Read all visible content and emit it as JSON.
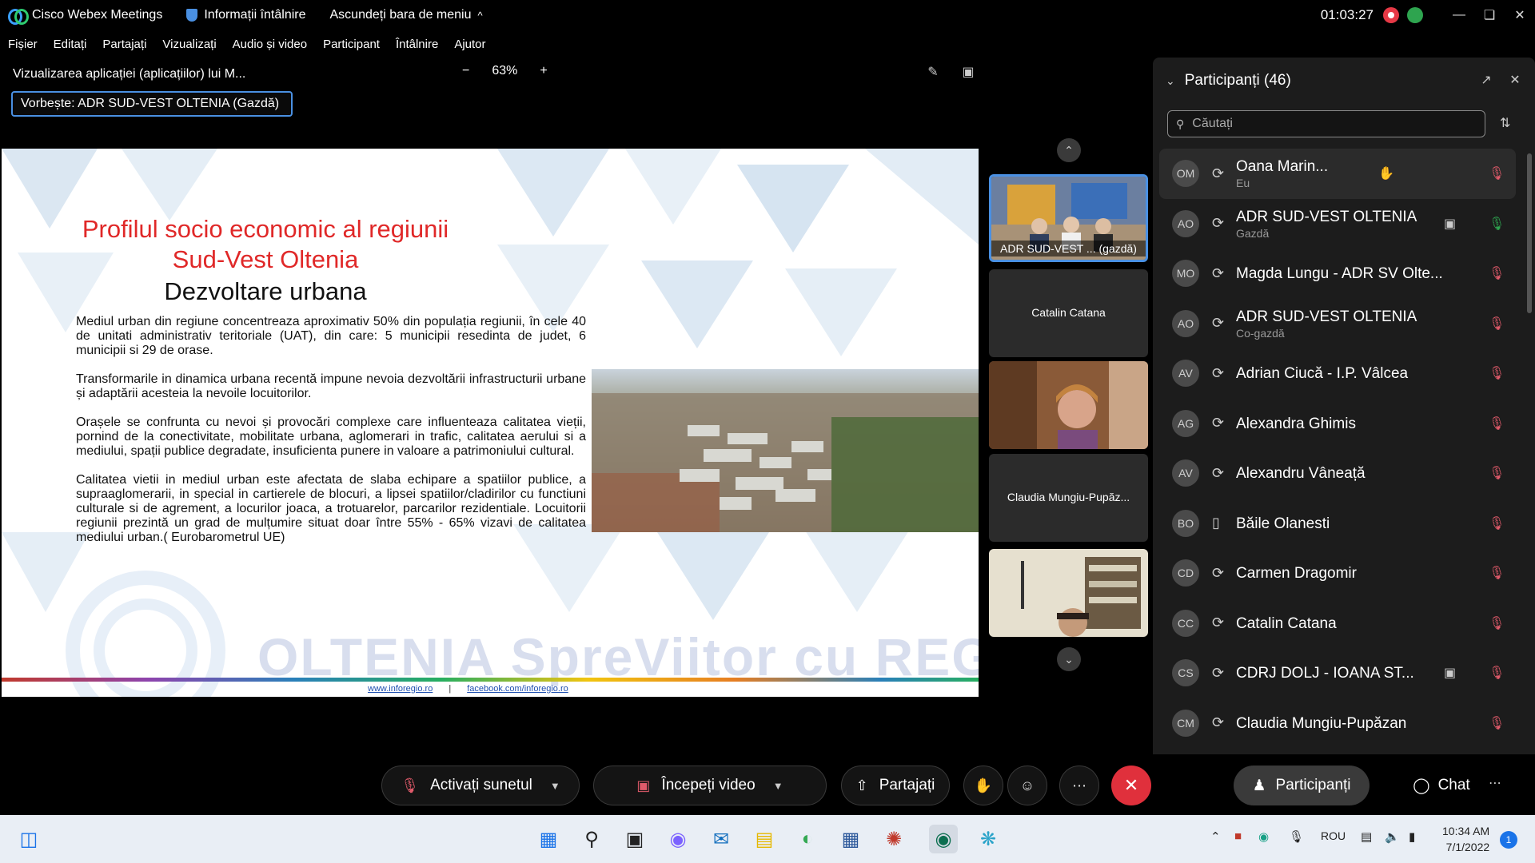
{
  "titlebar": {
    "app_name": "Cisco Webex Meetings",
    "meeting_info": "Informații întâlnire",
    "hide_menu": "Ascundeți bara de meniu",
    "hide_menu_chevron": "^",
    "timer": "01:03:27"
  },
  "menu": [
    "Fișier",
    "Editați",
    "Partajați",
    "Vizualizați",
    "Audio și video",
    "Participant",
    "Întâlnire",
    "Ajutor"
  ],
  "view": {
    "title": "Vizualizarea aplicației (aplicațiilor) lui M...",
    "zoom_minus": "−",
    "zoom": "63%",
    "zoom_plus": "+",
    "speaker": "Vorbește: ADR SUD-VEST OLTENIA (Gazdă)"
  },
  "slide": {
    "title1": "Profilul socio economic al regiunii",
    "title2": "Sud-Vest Oltenia",
    "title3": "Dezvoltare urbana",
    "p1": "Mediul urban din regiune concentreaza aproximativ 50% din populația regiunii, în cele 40 de unitati administrativ teritoriale (UAT), din care: 5 municipii resedinta de judet, 6 municipii si 29 de orase.",
    "p2": "Transformarile in dinamica urbana recentă impune nevoia dezvoltării infrastructurii urbane și adaptării acesteia la nevoile locuitorilor.",
    "p3": "Orașele se confrunta cu nevoi și provocări complexe care influenteaza calitatea vieții, pornind de la conectivitate, mobilitate urbana, aglomerari in trafic, calitatea aerului si a mediului, spații publice degradate, insuficienta punere in valoare a patrimoniului cultural.",
    "p4": "Calitatea vietii in mediul urban este afectata de slaba echipare a spatiilor publice, a supraaglomerarii, in special in cartierele de blocuri, a lipsei spatiilor/cladirilor cu functiuni culturale si de agrement, a locurilor joaca, a trotuarelor, parcarilor rezidentiale. Locuitorii regiunii prezintă un grad de mulțumire situat doar între 55% - 65% vizavi de calitatea mediului urban.( Eurobarometrul UE)",
    "watermark": "OLTENIA SpreViitor cu REGIO",
    "link1": "www.inforegio.ro",
    "link_sep": "|",
    "link2": "facebook.com/inforegio.ro"
  },
  "thumbnails": [
    {
      "label": "ADR SUD-VEST ... (gazdă)",
      "type": "video"
    },
    {
      "label": "Catalin Catana",
      "type": "name"
    },
    {
      "label": "",
      "type": "video"
    },
    {
      "label": "Claudia Mungiu-Pupăz...",
      "type": "name"
    },
    {
      "label": "",
      "type": "video"
    }
  ],
  "panel": {
    "title": "Participanți (46)",
    "search_placeholder": "Căutați",
    "participants": [
      {
        "initials": "OM",
        "name": "Oana Marin...",
        "role": "Eu",
        "icon": "hand-icon",
        "mic": "muted"
      },
      {
        "initials": "AO",
        "name": "ADR SUD-VEST OLTENIA",
        "role": "Gazdă",
        "icon": "video-icon",
        "mic": "on"
      },
      {
        "initials": "MO",
        "name": "Magda Lungu - ADR SV Olte...",
        "role": "",
        "icon": "",
        "mic": "muted"
      },
      {
        "initials": "AO",
        "name": "ADR SUD-VEST OLTENIA",
        "role": "Co-gazdă",
        "icon": "",
        "mic": "muted"
      },
      {
        "initials": "AV",
        "name": "Adrian Ciucă - I.P. Vâlcea",
        "role": "",
        "icon": "",
        "mic": "muted"
      },
      {
        "initials": "AG",
        "name": "Alexandra Ghimis",
        "role": "",
        "icon": "",
        "mic": "muted"
      },
      {
        "initials": "AV",
        "name": "Alexandru Vâneață",
        "role": "",
        "icon": "",
        "mic": "muted"
      },
      {
        "initials": "BO",
        "name": "Băile Olanesti",
        "role": "",
        "icon": "",
        "mic": "muted"
      },
      {
        "initials": "CD",
        "name": "Carmen Dragomir",
        "role": "",
        "icon": "",
        "mic": "muted"
      },
      {
        "initials": "CC",
        "name": "Catalin Catana",
        "role": "",
        "icon": "",
        "mic": "muted"
      },
      {
        "initials": "CS",
        "name": "CDRJ DOLJ - IOANA ST...",
        "role": "",
        "icon": "video-icon",
        "mic": "muted"
      },
      {
        "initials": "CM",
        "name": "Claudia Mungiu-Pupăzan",
        "role": "",
        "icon": "",
        "mic": "muted"
      }
    ]
  },
  "controls": {
    "unmute": "Activați sunetul",
    "start_video": "Începeți video",
    "share": "Partajați",
    "participants": "Participanți",
    "chat": "Chat"
  },
  "taskbar": {
    "lang": "ROU",
    "time": "10:34 AM",
    "date": "7/1/2022",
    "notifications": "1"
  },
  "colors": {
    "accent": "#4a90e2",
    "end_call": "#e0303c",
    "slide_title_red": "#e02828",
    "muted_mic": "#e05a6a",
    "active_mic": "#2ea44f"
  }
}
